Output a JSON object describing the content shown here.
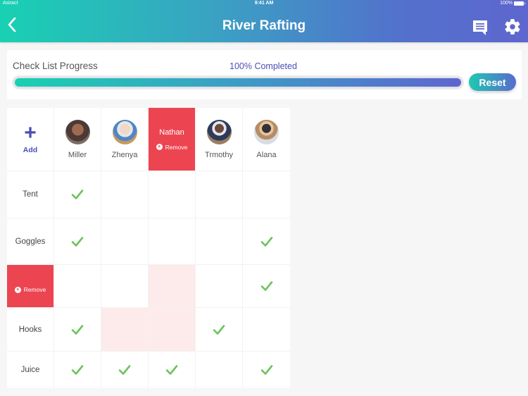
{
  "status_bar": {
    "carrier": "Asiract",
    "time": "9:41 AM",
    "battery": "100%"
  },
  "header": {
    "title": "River Rafting",
    "back_icon": "chevron-left-icon",
    "chat_icon": "message-icon",
    "settings_icon": "gear-icon"
  },
  "progress": {
    "label": "Check List Progress",
    "percent_text": "100% Completed",
    "value": 100,
    "reset_label": "Reset"
  },
  "colors": {
    "accent_start": "#18d1b3",
    "accent_end": "#5e66cf",
    "remove_red": "#ec4551",
    "highlight_pink": "#fdeaea",
    "check_green": "#6cc35a",
    "text_purple": "#4a4fb5"
  },
  "grid": {
    "add_label": "Add",
    "people": [
      {
        "name": "Miller",
        "state": "normal"
      },
      {
        "name": "Zhenya",
        "state": "normal"
      },
      {
        "name": "Nathan",
        "state": "removing",
        "remove_label": "Remove"
      },
      {
        "name": "Trmothy",
        "state": "normal"
      },
      {
        "name": "Alana",
        "state": "normal"
      }
    ],
    "items": [
      {
        "name": "Tent",
        "state": "normal",
        "checks": [
          true,
          false,
          false,
          false,
          false
        ],
        "highlight": [
          false,
          false,
          false,
          false,
          false
        ]
      },
      {
        "name": "Goggles",
        "state": "normal",
        "checks": [
          true,
          false,
          false,
          false,
          true
        ],
        "highlight": [
          false,
          false,
          false,
          false,
          false
        ]
      },
      {
        "name": "",
        "state": "removing",
        "remove_label": "Remove",
        "checks": [
          false,
          false,
          false,
          false,
          true
        ],
        "highlight": [
          false,
          false,
          true,
          false,
          false
        ]
      },
      {
        "name": "Hooks",
        "state": "normal",
        "checks": [
          true,
          false,
          false,
          true,
          false
        ],
        "highlight": [
          false,
          true,
          true,
          false,
          false
        ]
      },
      {
        "name": "Juice",
        "state": "normal",
        "checks": [
          true,
          true,
          true,
          false,
          true
        ],
        "highlight": [
          false,
          false,
          false,
          false,
          false
        ]
      }
    ]
  }
}
